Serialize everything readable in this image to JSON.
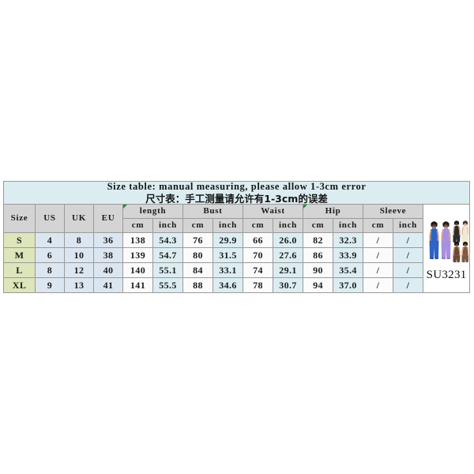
{
  "title": {
    "english": "Size table: manual measuring, please allow 1-3cm error",
    "chinese": "尺寸表：手工测量请允许有1-3cm的误差"
  },
  "table": {
    "id_headers": [
      "Size",
      "US",
      "UK",
      "EU"
    ],
    "measurement_groups": [
      "length",
      "Bust",
      "Waist",
      "Hip",
      "Sleeve"
    ],
    "unit_headers": [
      "cm",
      "inch",
      "cm",
      "inch",
      "cm",
      "inch",
      "cm",
      "inch",
      "cm",
      "inch"
    ],
    "rows": [
      {
        "size": "S",
        "us": "4",
        "uk": "8",
        "eu": "36",
        "length_cm": "138",
        "length_inch": "54.3",
        "bust_cm": "76",
        "bust_inch": "29.9",
        "waist_cm": "66",
        "waist_inch": "26.0",
        "hip_cm": "82",
        "hip_inch": "32.3",
        "sleeve_cm": "/",
        "sleeve_inch": "/"
      },
      {
        "size": "M",
        "us": "6",
        "uk": "10",
        "eu": "38",
        "length_cm": "139",
        "length_inch": "54.7",
        "bust_cm": "80",
        "bust_inch": "31.5",
        "waist_cm": "70",
        "waist_inch": "27.6",
        "hip_cm": "86",
        "hip_inch": "33.9",
        "sleeve_cm": "/",
        "sleeve_inch": "/"
      },
      {
        "size": "L",
        "us": "8",
        "uk": "12",
        "eu": "40",
        "length_cm": "140",
        "length_inch": "55.1",
        "bust_cm": "84",
        "bust_inch": "33.1",
        "waist_cm": "74",
        "waist_inch": "29.1",
        "hip_cm": "90",
        "hip_inch": "35.4",
        "sleeve_cm": "/",
        "sleeve_inch": "/"
      },
      {
        "size": "XL",
        "us": "9",
        "uk": "13",
        "eu": "41",
        "length_cm": "141",
        "length_inch": "55.5",
        "bust_cm": "88",
        "bust_inch": "34.6",
        "waist_cm": "78",
        "waist_inch": "30.7",
        "hip_cm": "94",
        "hip_inch": "37.0",
        "sleeve_cm": "/",
        "sleeve_inch": "/"
      }
    ]
  },
  "product": {
    "code": "SU3231",
    "image_name": "jumpsuit-color-variants",
    "variant_colors": [
      "#2f63c4",
      "#a98fe0",
      "#2a2a2a",
      "#efe7d7"
    ]
  },
  "colors": {
    "title_band": "#dcedf2",
    "header_grey": "#d4d4d4",
    "size_green": "#dde5bb",
    "id_blue": "#dce6f1",
    "inch_blue": "#dcedf2",
    "cm_white": "#fbfbfb",
    "border_outer": "#404040",
    "border_inner": "#9a9a9a",
    "comment_marker": "#1f8a3b"
  }
}
